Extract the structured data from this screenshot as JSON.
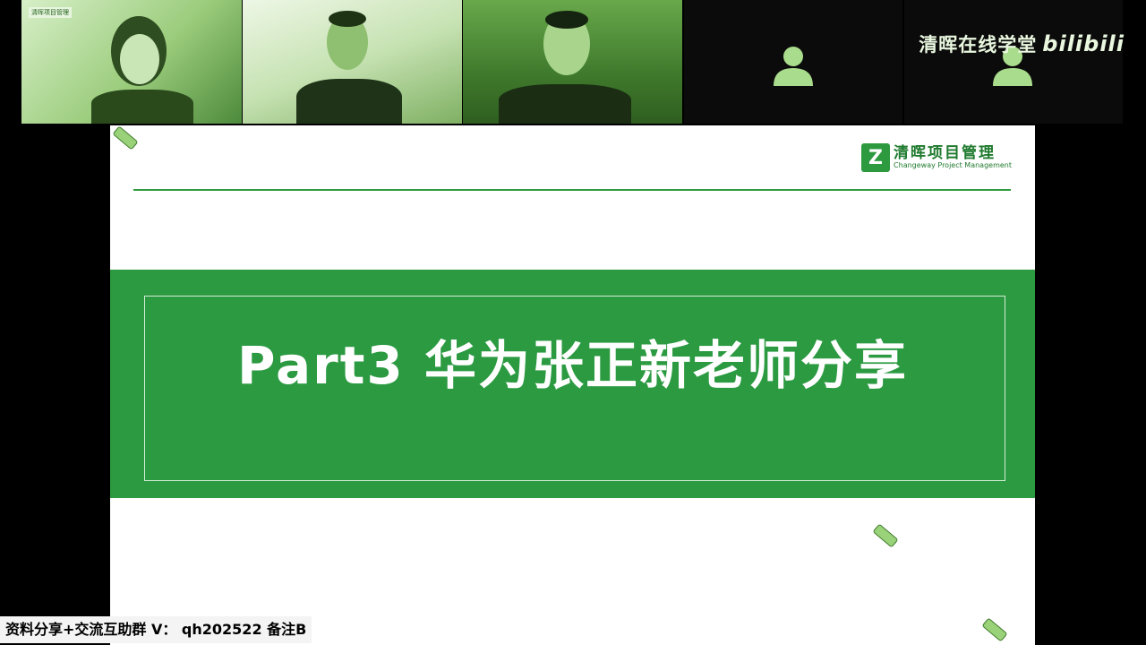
{
  "brand": {
    "text": "清晖在线学堂",
    "site": "bilibili"
  },
  "participants": [
    {
      "name": "speaker-1",
      "tile_logo": "清晖项目管理"
    },
    {
      "name": "speaker-2"
    },
    {
      "name": "speaker-3"
    },
    {
      "name": "empty-1",
      "avatar_icon": "person-icon"
    },
    {
      "name": "empty-2",
      "avatar_icon": "person-icon"
    }
  ],
  "slide": {
    "logo_cn": "清晖项目管理",
    "logo_en": "Changeway Project Management",
    "logo_mark": "Z",
    "title": "Part3 华为张正新老师分享"
  },
  "footer": {
    "text": "资料分享+交流互助群 V： qh202522 备注B"
  },
  "colors": {
    "accent": "#2b9a41",
    "tile_green": "#3f7a2c"
  }
}
